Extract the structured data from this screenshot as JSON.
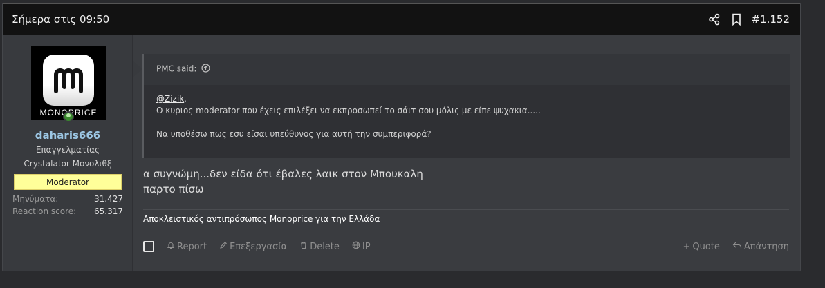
{
  "post": {
    "date": "Σήμερα στις 09:50",
    "number": "#1.152",
    "icons": {
      "share": "share-icon",
      "bookmark": "bookmark-icon"
    }
  },
  "user": {
    "avatar_text": "MONOPRICE",
    "name": "daharis666",
    "title1": "Επαγγελματίας",
    "title2": "Crystalator Μονολιθξ",
    "badge": "Moderator",
    "stats": [
      {
        "label": "Μηνύματα:",
        "value": "31.427"
      },
      {
        "label": "Reaction score:",
        "value": "65.317"
      }
    ],
    "username_color": "#9cc6e3",
    "badge_color": "#ffff99"
  },
  "quote": {
    "attribution": "PMC said:",
    "mention": "@Zizik",
    "mention_suffix": ".",
    "line1": "Ο κυριος moderator που έχεις επιλέξει να εκπροσωπεί το σάιτ σου μόλις με είπε ψυχακια.....",
    "line2": "Να υποθέσω πως εσυ είσαι υπεύθυνος για αυτή την συμπεριφορά?"
  },
  "message": {
    "line1": "α συγνώμη...δεν είδα ότι έβαλες λαικ στον Μπουκαλη",
    "line2": "παρτο πίσω"
  },
  "signature": "Αποκλειστικός αντιπρόσωπος Monoprice για την Ελλάδα",
  "actions": {
    "report": "Report",
    "edit": "Επεξεργασία",
    "delete": "Delete",
    "ip": "IP",
    "quote": "Quote",
    "reply": "Απάντηση"
  }
}
